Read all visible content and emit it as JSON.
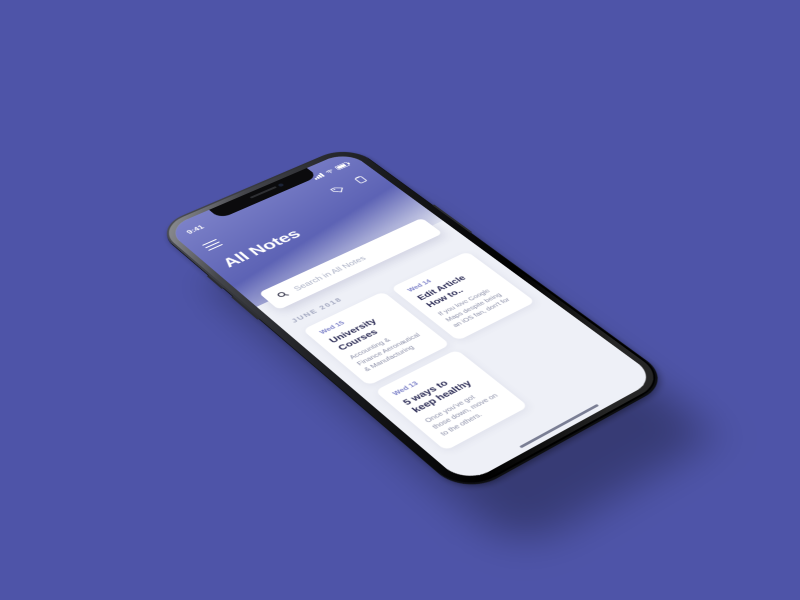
{
  "statusbar": {
    "time": "9:41"
  },
  "header": {
    "title": "All Notes"
  },
  "search": {
    "placeholder": "Search in All Notes"
  },
  "section": {
    "label": "JUNE 2018"
  },
  "notes": [
    {
      "date": "Wed 15",
      "title": "University Courses",
      "excerpt": "Accounting & Finance Aeronautical & Manufacturing"
    },
    {
      "date": "Wed 14",
      "title": "Edit Article How to..",
      "excerpt": "If you love Google Maps despite being an iOS fan, don't for"
    },
    {
      "date": "Wed 13",
      "title": "5 ways to keep healthy",
      "excerpt": "Once you've got those down, move on to the others."
    }
  ]
}
